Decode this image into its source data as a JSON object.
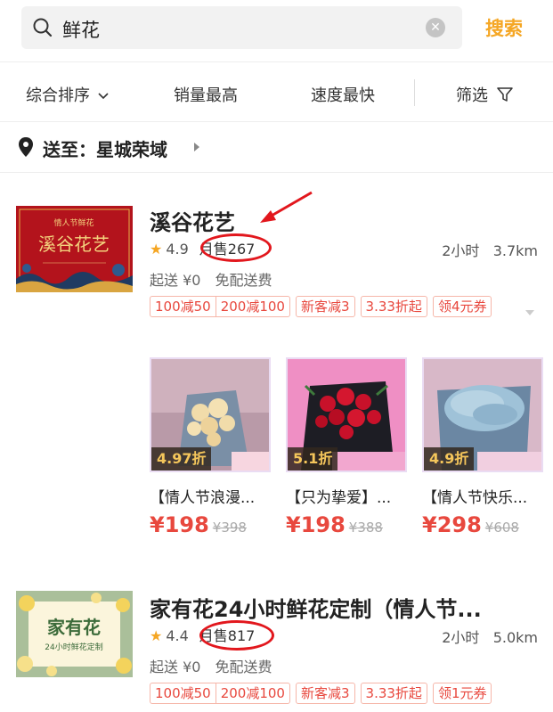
{
  "search": {
    "query": "鲜花",
    "button": "搜索"
  },
  "sort": {
    "items": [
      "综合排序",
      "销量最高",
      "速度最快",
      "筛选"
    ]
  },
  "address": {
    "label": "送至：星城荣域"
  },
  "shops": [
    {
      "name": "溪谷花艺",
      "logo_title": "溪谷花艺",
      "logo_sub": "情人节鲜花",
      "rating": "4.9",
      "monthly": "月售267",
      "time": "2小时",
      "distance": "3.7km",
      "min_order": "起送 ¥0",
      "delivery": "免配送费",
      "tags": [
        "100减50",
        "200减100",
        "新客减3",
        "3.33折起",
        "领4元券"
      ],
      "products": [
        {
          "discount": "4.97折",
          "name": "【情人节浪漫...",
          "price": "¥198",
          "orig": "¥398"
        },
        {
          "discount": "5.1折",
          "name": "【只为挚爱】...",
          "price": "¥198",
          "orig": "¥388"
        },
        {
          "discount": "4.9折",
          "name": "【情人节快乐...",
          "price": "¥298",
          "orig": "¥608"
        }
      ]
    },
    {
      "name": "家有花24小时鲜花定制（情人节...",
      "logo_title": "家有花",
      "logo_sub": "24小时鲜花定制",
      "rating": "4.4",
      "monthly": "月售817",
      "time": "2小时",
      "distance": "5.0km",
      "min_order": "起送 ¥0",
      "delivery": "免配送费",
      "tags": [
        "100减50",
        "200减100",
        "新客减3",
        "3.33折起",
        "领1元券"
      ]
    }
  ],
  "colors": {
    "accent": "#f5a623",
    "price": "#e8483e",
    "annotation": "#e2171d"
  }
}
